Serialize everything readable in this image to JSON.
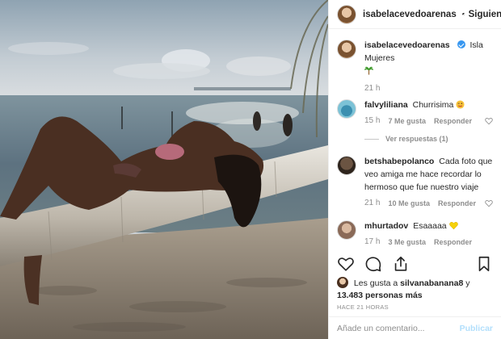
{
  "post": {
    "author": "isabelacevedoarenas",
    "follow_status": "Siguiendo",
    "separator": "•",
    "caption_author": "isabelacevedoarenas",
    "location": "Isla Mujeres",
    "caption_time": "21 h"
  },
  "comments": [
    {
      "user": "falvyliliana",
      "text": "Churrisima",
      "time": "15 h",
      "likes": "7 Me gusta",
      "reply": "Responder",
      "replies": "Ver respuestas (1)"
    },
    {
      "user": "betshabepolanco",
      "text": "Cada foto que veo amiga me hace recordar lo hermoso que fue nuestro viaje",
      "time": "21 h",
      "likes": "10 Me gusta",
      "reply": "Responder"
    },
    {
      "user": "mhurtadov",
      "text": "Esaaaaa",
      "time": "17 h",
      "likes": "3 Me gusta",
      "reply": "Responder"
    }
  ],
  "likes_summary": {
    "prefix": "Les gusta a",
    "user": "silvanabanana8",
    "connector": "y",
    "count": "13.483 personas más"
  },
  "post_age": "HACE 21 HORAS",
  "add_comment": {
    "placeholder": "Añade un comentario...",
    "publish_label": "Publicar"
  },
  "colors": {
    "verified": "#3897f0",
    "secondary_text": "#8e8e8e",
    "publish_disabled": "#b2dffc"
  },
  "icons": [
    "verified-badge-icon",
    "palm-tree-emoji",
    "heart-icon",
    "comment-icon",
    "share-icon",
    "bookmark-icon",
    "yellow-heart-emoji",
    "wink-emoji"
  ]
}
